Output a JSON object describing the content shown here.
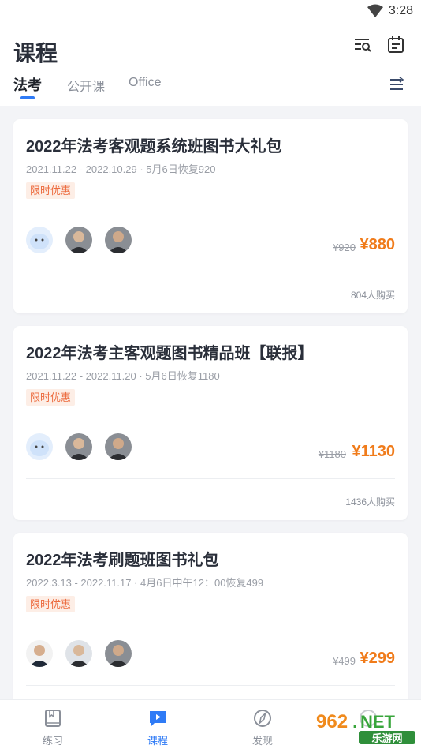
{
  "status_bar": {
    "time": "3:28",
    "wifi_icon": "wifi-icon"
  },
  "header": {
    "title": "课程",
    "icons": [
      "search-list-icon",
      "calendar-icon"
    ],
    "tabs": [
      {
        "label": "法考",
        "active": true
      },
      {
        "label": "公开课",
        "active": false
      },
      {
        "label": "Office",
        "active": false
      }
    ],
    "menu_icon": "sort-menu-icon"
  },
  "colors": {
    "accent": "#2f7bf6",
    "price": "#f07b1a",
    "promo_text": "#ec6a3d",
    "promo_bg": "#fdeee6"
  },
  "courses": [
    {
      "title": "2022年法考客观题系统班图书大礼包",
      "date": "2021.11.22 - 2022.10.29 · 5月6日恢复920",
      "badge": "限时优惠",
      "avatars": [
        "mascot-avatar",
        "teacher-avatar",
        "teacher-avatar"
      ],
      "old_price": "¥920",
      "price": "¥880",
      "buyers": "804人购买"
    },
    {
      "title": "2022年法考主客观题图书精品班【联报】",
      "date": "2021.11.22 - 2022.11.20 · 5月6日恢复1180",
      "badge": "限时优惠",
      "avatars": [
        "mascot-avatar",
        "teacher-avatar",
        "teacher-avatar"
      ],
      "old_price": "¥1180",
      "price": "¥1130",
      "buyers": "1436人购买"
    },
    {
      "title": "2022年法考刷题班图书礼包",
      "date": "2022.3.13 - 2022.11.17 · 4月6日中午12：00恢复499",
      "badge": "限时优惠",
      "avatars": [
        "teacher-avatar",
        "teacher-avatar",
        "teacher-avatar"
      ],
      "old_price": "¥499",
      "price": "¥299",
      "buyers": ""
    }
  ],
  "tabbar": {
    "items": [
      {
        "label": "练习",
        "icon": "book-icon",
        "active": false
      },
      {
        "label": "课程",
        "icon": "play-icon",
        "active": true
      },
      {
        "label": "发现",
        "icon": "compass-icon",
        "active": false
      },
      {
        "label": "",
        "icon": "profile-icon",
        "active": false
      }
    ]
  },
  "watermark": {
    "top": "962",
    "dot": ".",
    "net": "NET",
    "bottom": "乐游网"
  }
}
